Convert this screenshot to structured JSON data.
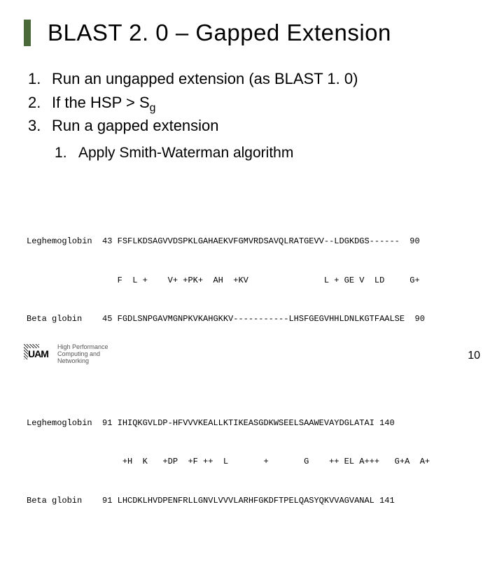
{
  "title": "BLAST 2. 0 – Gapped Extension",
  "list": {
    "item1": "Run an ungapped extension (as BLAST 1. 0)",
    "item2_pre": "If the HSP > S",
    "item2_sub": "g",
    "item3": "Run a gapped extension",
    "sub1": "Apply Smith-Waterman algorithm"
  },
  "alignment": {
    "group1": {
      "l1": "Leghemoglobin  43 FSFLKDSAGVVDSPKLGAHAEKVFGMVRDSAVQLRATGEVV--LDGKDGS------  90",
      "l2": "                  F  L +    V+ +PK+  AH  +KV               L + GE V  LD     G+    ",
      "l3": "Beta globin    45 FGDLSNPGAVMGNPKVKAHGKKV-----------LHSFGEGVHHLDNLKGTFAALSE  90"
    },
    "group2": {
      "l1": "Leghemoglobin  91 IHIQKGVLDP-HFVVVKEALLKTIKEASGDKWSEELSAAWEVAYDGLATAI 140",
      "l2": "                   +H  K   +DP  +F ++  L       +       G    ++ EL A+++   G+A  A+",
      "l3": "Beta globin    91 LHCDKLHVDPENFRLLGNVLVVVLARHFGKDFTPELQASYQKVVAGVANAL 141"
    }
  },
  "footer": {
    "logo_letters": "UAM",
    "logo_line1": "High Performance",
    "logo_line2": "Computing and",
    "logo_line3": "Networking"
  },
  "page_number": "10"
}
